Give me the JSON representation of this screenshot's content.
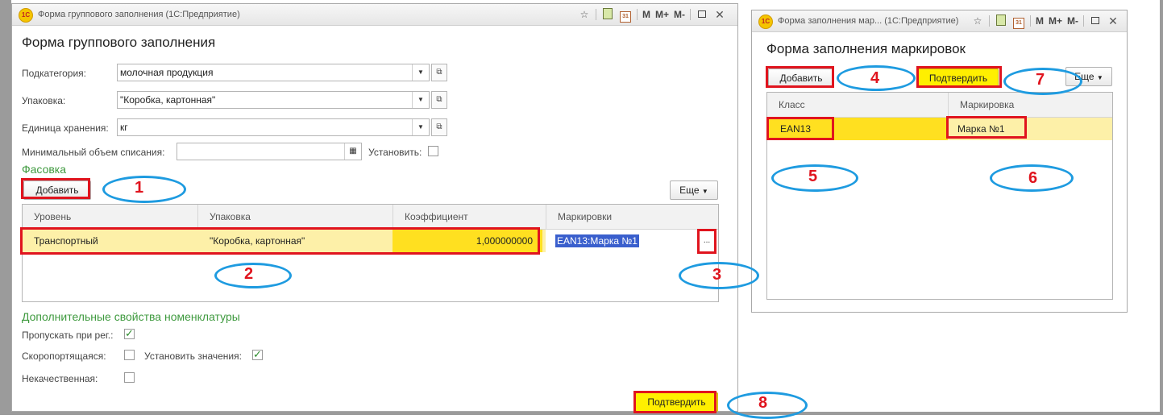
{
  "left_window": {
    "title": "Форма группового заполнения  (1С:Предприятие)",
    "form_title": "Форма группового заполнения",
    "subcategory_label": "Подкатегория:",
    "subcategory_value": "молочная продукция",
    "packaging_label": "Упаковка:",
    "packaging_value": "\"Коробка, картонная\"",
    "unit_label": "Единица хранения:",
    "unit_value": "кг",
    "min_volume_label": "Минимальный объем списания:",
    "min_volume_value": "",
    "set_label": "Установить:",
    "fasovka_title": "Фасовка",
    "add_button": "Добавить",
    "more_button": "Еще",
    "table": {
      "columns": [
        "Уровень",
        "Упаковка",
        "Коэффициент",
        "Маркировки"
      ],
      "rows": [
        {
          "level": "Транспортный",
          "packaging": "\"Коробка, картонная\"",
          "coefficient": "1,000000000",
          "markings": "EAN13:Марка №1"
        }
      ]
    },
    "extra_props_title": "Дополнительные свойства номенклатуры",
    "skip_label": "Пропускать при рег.:",
    "skip_checked": true,
    "perishable_label": "Скоропортящаяся:",
    "perishable_checked": false,
    "set_values_label": "Установить значения:",
    "set_values_checked": true,
    "low_quality_label": "Некачественная:",
    "low_quality_checked": false,
    "confirm_button": "Подтвердить"
  },
  "right_window": {
    "title": "Форма заполнения мар...  (1С:Предприятие)",
    "form_title": "Форма заполнения маркировок",
    "add_button": "Добавить",
    "confirm_button": "Подтвердить",
    "more_button": "Еще",
    "table": {
      "columns": [
        "Класс",
        "Маркировка"
      ],
      "rows": [
        {
          "class": "EAN13",
          "marking": "Марка №1"
        }
      ]
    }
  },
  "titlebar_icons": {
    "m": "M",
    "m_plus": "M+",
    "m_minus": "M-"
  },
  "annotations": [
    "1",
    "2",
    "3",
    "4",
    "5",
    "6",
    "7",
    "8"
  ],
  "colors": {
    "accent_red": "#e0141e",
    "ellipse_blue": "#1e9be0",
    "selected_row": "#fdf0a8",
    "selected_cell": "#ffe020",
    "confirm_button": "#ffef00",
    "section_green": "#3f9a3f"
  }
}
